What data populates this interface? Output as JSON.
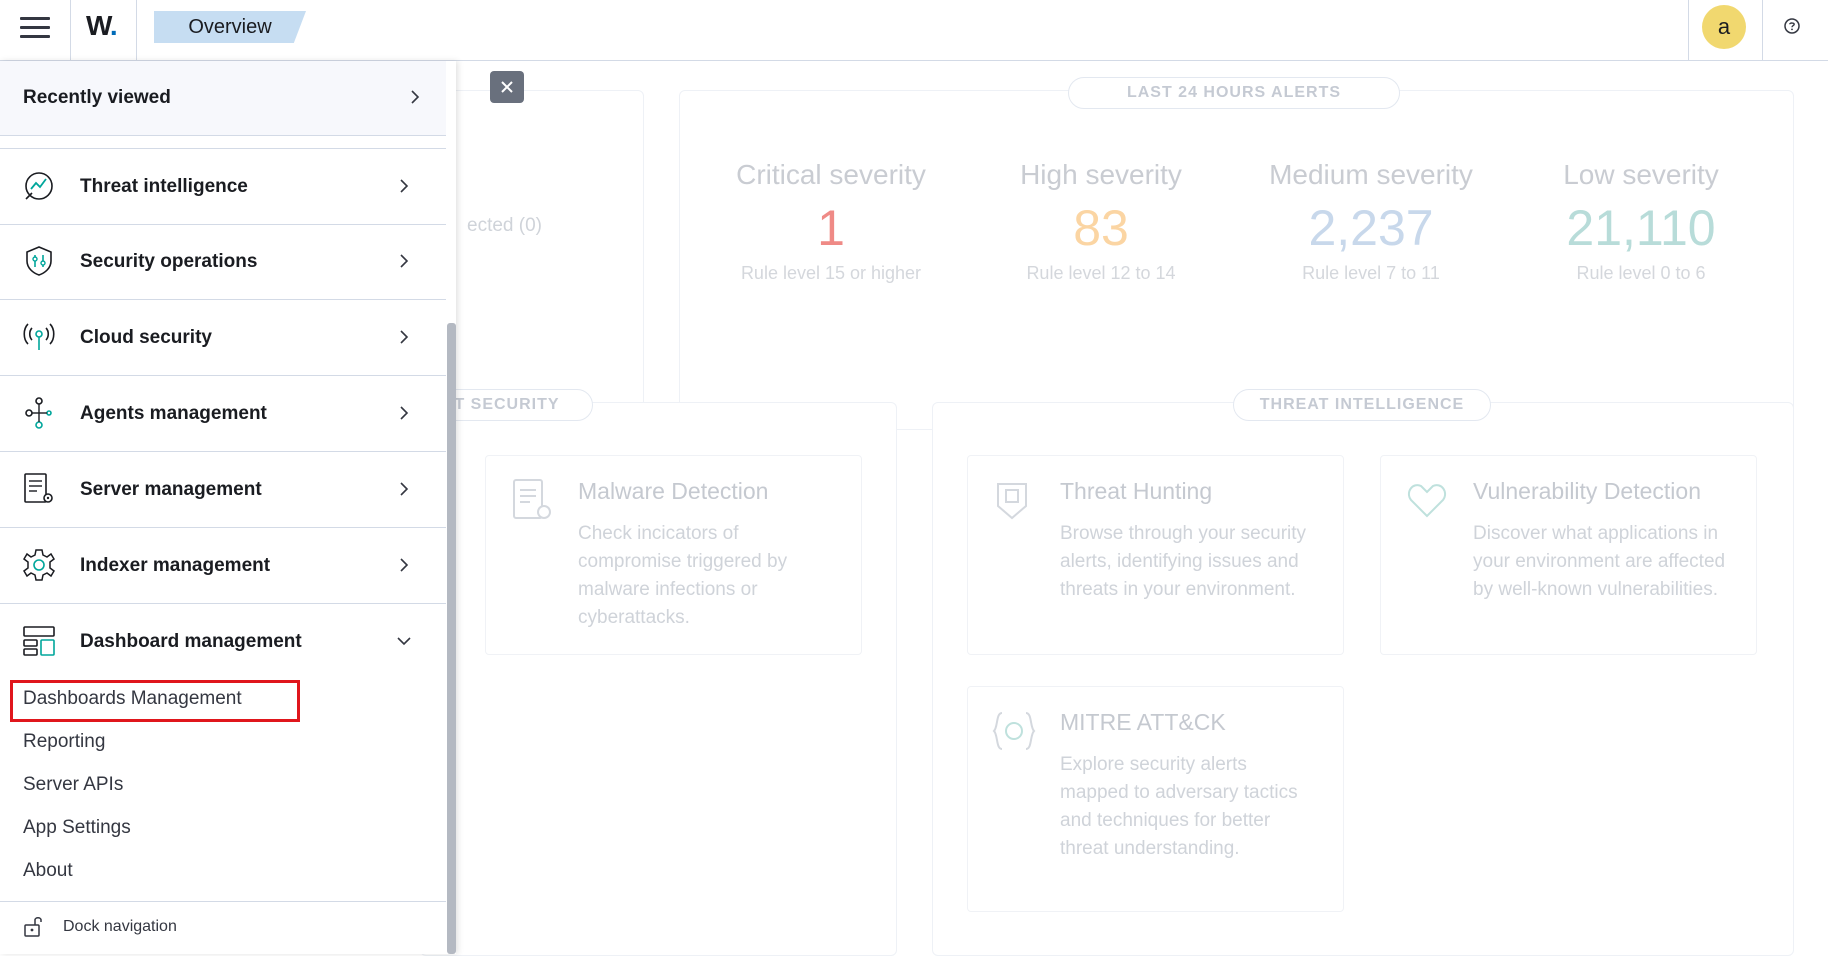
{
  "header": {
    "logo_text": "W",
    "logo_dot": ".",
    "breadcrumb": "Overview",
    "avatar_letter": "a",
    "help_icon": "question-circle-icon"
  },
  "background": {
    "left_partial_text": "ected (0)",
    "alerts_title": "LAST 24 HOURS ALERTS",
    "severities": [
      {
        "title": "Critical severity",
        "value": "1",
        "desc": "Rule level 15 or higher",
        "color": "#ef8a86"
      },
      {
        "title": "High severity",
        "value": "83",
        "desc": "Rule level 12 to 14",
        "color": "#fbd5a3"
      },
      {
        "title": "Medium severity",
        "value": "2,237",
        "desc": "Rule level 7 to 11",
        "color": "#c8d8eb"
      },
      {
        "title": "Low severity",
        "value": "21,110",
        "desc": "Rule level 0 to 6",
        "color": "#b8dcd9"
      }
    ],
    "endpoint_section_title": "T SECURITY",
    "threat_section_title": "THREAT INTELLIGENCE",
    "cards": [
      {
        "title": "Malware Detection",
        "desc": "Check incicators of compromise triggered by malware infections or cyberattacks."
      },
      {
        "title": "Threat Hunting",
        "desc": "Browse through your security alerts, identifying issues and threats in your environment."
      },
      {
        "title": "Vulnerability Detection",
        "desc": "Discover what applications in your environment are affected by well-known vulnerabilities."
      },
      {
        "title": "MITRE ATT&CK",
        "desc": "Explore security alerts mapped to adversary tactics and techniques for better threat understanding."
      }
    ]
  },
  "nav": {
    "recently_viewed": "Recently viewed",
    "items": [
      {
        "label": "Threat intelligence",
        "icon": "threat-intel-icon"
      },
      {
        "label": "Security operations",
        "icon": "shield-icon"
      },
      {
        "label": "Cloud security",
        "icon": "cloud-signal-icon"
      },
      {
        "label": "Agents management",
        "icon": "agents-icon"
      },
      {
        "label": "Server management",
        "icon": "server-doc-icon"
      },
      {
        "label": "Indexer management",
        "icon": "gear-icon"
      },
      {
        "label": "Dashboard management",
        "icon": "dashboard-icon"
      }
    ],
    "subitems": [
      "Dashboards Management",
      "Reporting",
      "Server APIs",
      "App Settings",
      "About"
    ],
    "dock_label": "Dock navigation"
  },
  "colors": {
    "highlight_box": "#e0161c",
    "accent": "#006bb8",
    "breadcrumb_bg": "#c6ddf2",
    "avatar_bg": "#f1d86f"
  }
}
